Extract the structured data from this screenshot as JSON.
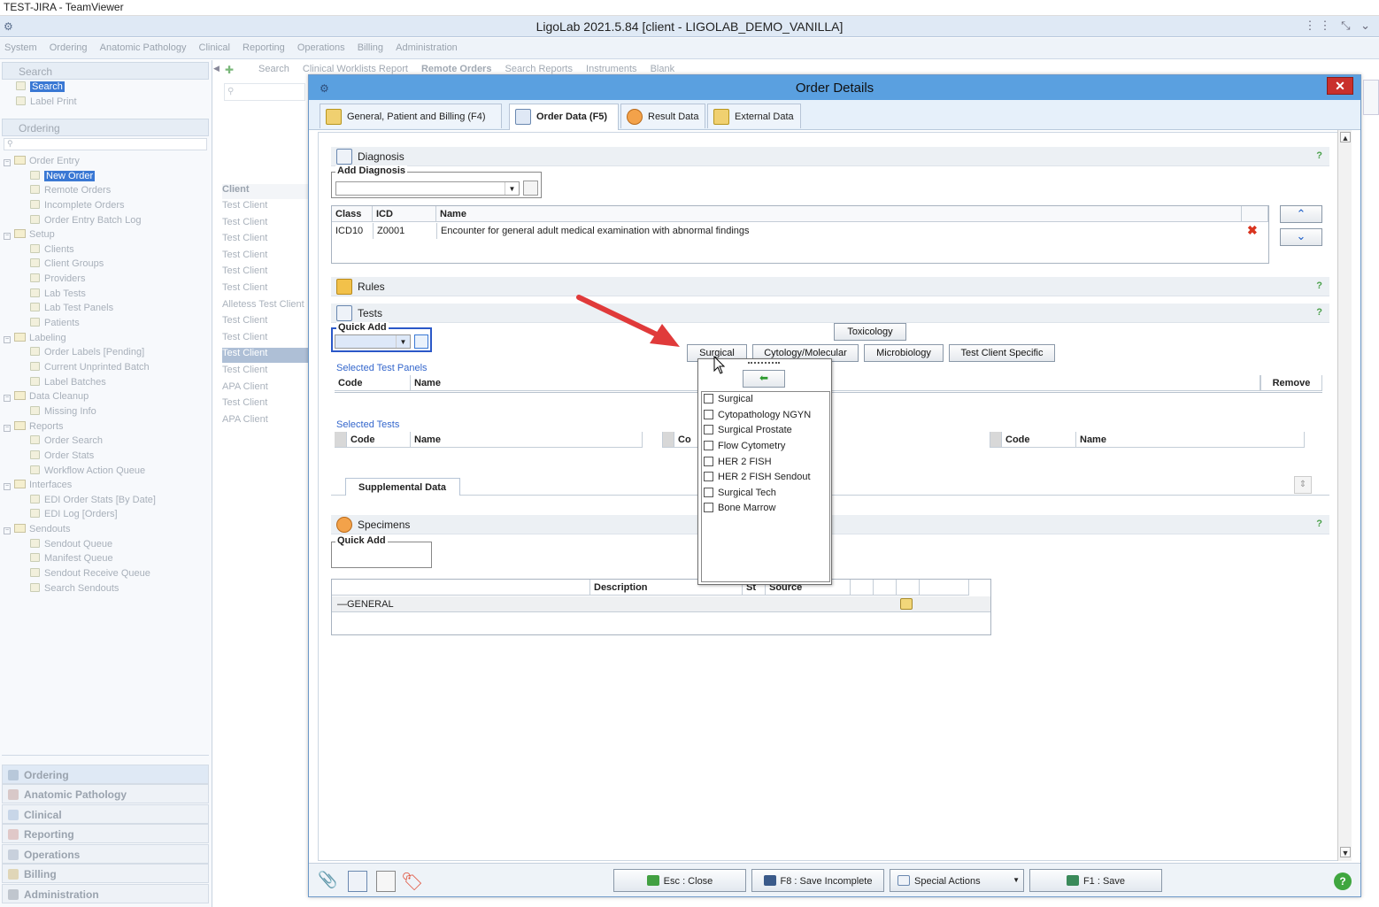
{
  "teamviewer": {
    "title": "TEST-JIRA - TeamViewer"
  },
  "app": {
    "title": "LigoLab 2021.5.84 [client - LIGOLAB_DEMO_VANILLA]"
  },
  "menu": [
    "System",
    "Ordering",
    "Anatomic Pathology",
    "Clinical",
    "Reporting",
    "Operations",
    "Billing",
    "Administration"
  ],
  "left": {
    "search_section": "Search",
    "search_items": [
      "Search",
      "Label Print"
    ],
    "ordering_section": "Ordering",
    "tree": {
      "order_entry": "Order Entry",
      "order_entry_items": [
        "New Order",
        "Remote Orders",
        "Incomplete Orders",
        "Order Entry Batch Log"
      ],
      "setup": "Setup",
      "setup_items": [
        "Clients",
        "Client Groups",
        "Providers",
        "Lab Tests",
        "Lab Test Panels",
        "Patients"
      ],
      "labeling": "Labeling",
      "labeling_items": [
        "Order Labels [Pending]",
        "Current Unprinted Batch",
        "Label Batches"
      ],
      "data_cleanup": "Data Cleanup",
      "data_cleanup_items": [
        "Missing Info"
      ],
      "reports": "Reports",
      "reports_items": [
        "Order Search",
        "Order Stats",
        "Workflow Action Queue"
      ],
      "interfaces": "Interfaces",
      "interfaces_items": [
        "EDI Order Stats [By Date]",
        "EDI Log [Orders]"
      ],
      "sendouts": "Sendouts",
      "sendouts_items": [
        "Sendout Queue",
        "Manifest Queue",
        "Sendout Receive Queue",
        "Search Sendouts"
      ]
    },
    "nav_buttons": [
      "Ordering",
      "Anatomic Pathology",
      "Clinical",
      "Reporting",
      "Operations",
      "Billing",
      "Administration"
    ]
  },
  "background": {
    "tabs": [
      "Search",
      "Clinical Worklists Report",
      "Remote Orders",
      "Search Reports",
      "Instruments",
      "Blank"
    ],
    "list_header": "Client",
    "list_rows": [
      "Test Client",
      "Test Client",
      "Test Client",
      "Test Client",
      "Test Client",
      "Test Client",
      "Alletess Test Client",
      "Test Client",
      "Test Client",
      "Test Client",
      "Test Client",
      "APA Client",
      "Test Client",
      "APA Client"
    ]
  },
  "dialog": {
    "title": "Order Details",
    "close": "✕",
    "tabs": [
      "General, Patient and Billing (F4)",
      "Order Data (F5)",
      "Result Data",
      "External Data"
    ],
    "diagnosis": {
      "title": "Diagnosis",
      "add_label": "Add Diagnosis",
      "help": "?",
      "columns": [
        "Class",
        "ICD",
        "Name"
      ],
      "rows": [
        {
          "class": "ICD10",
          "icd": "Z0001",
          "name": "Encounter for general adult medical examination with abnormal findings"
        }
      ]
    },
    "rules": {
      "title": "Rules",
      "help": "?"
    },
    "tests": {
      "title": "Tests",
      "help": "?",
      "quick_add_label": "Quick Add",
      "toxicology": "Toxicology",
      "categories": [
        "Surgical",
        "Cytology/Molecular",
        "Microbiology",
        "Test Client Specific"
      ],
      "selected_panels_label": "Selected Test Panels",
      "panels_columns": [
        "Code",
        "Name",
        "Remove"
      ],
      "selected_tests_label": "Selected Tests",
      "tests_columns_left": [
        "Code",
        "Name"
      ],
      "tests_columns_mid": [
        "Co"
      ],
      "tests_columns_right": [
        "Code",
        "Name"
      ],
      "supplemental_tab": "Supplemental Data",
      "popup_items": [
        "Surgical",
        "Cytopathology NGYN",
        "Surgical Prostate",
        "Flow Cytometry",
        "HER 2 FISH",
        "HER 2 FISH Sendout",
        "Surgical Tech",
        "Bone Marrow"
      ]
    },
    "specimens": {
      "title": "Specimens",
      "help": "?",
      "quick_add_label": "Quick Add",
      "columns": [
        "Description",
        "St",
        "Source"
      ],
      "row_label": "—GENERAL"
    },
    "footer": {
      "close": "Esc : Close",
      "save_incomplete": "F8 : Save Incomplete",
      "special_actions": "Special Actions",
      "save": "F1 : Save"
    }
  }
}
